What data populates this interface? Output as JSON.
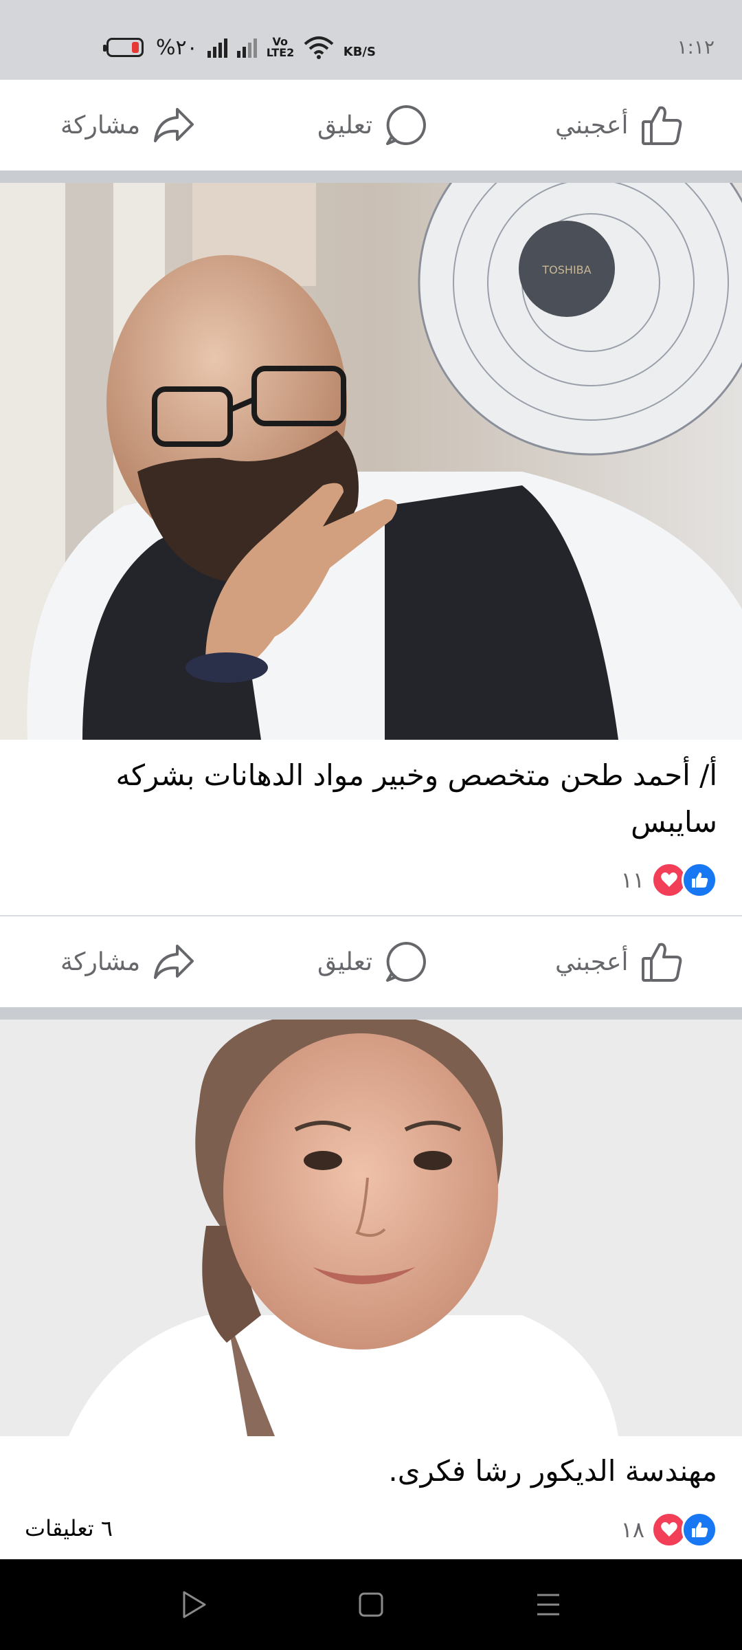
{
  "status_bar": {
    "time": "١:١٢",
    "battery_percent": "%٢٠",
    "network_speed": "KB/S",
    "volte": "Vo LTE2",
    "icons": [
      "battery-icon",
      "signal-icon",
      "signal-icon",
      "volte-icon",
      "wifi-icon"
    ]
  },
  "post_actions": {
    "like": "أعجبني",
    "comment": "تعليق",
    "share": "مشاركة"
  },
  "posts": [
    {
      "image_alt": "bald man with beard and glasses gesturing, fan in background",
      "caption": "أ/ أحمد طحن متخصص وخبير مواد الدهانات بشركه سايبس",
      "reaction_count": "١١",
      "reactions": [
        "like",
        "love"
      ]
    },
    {
      "image_alt": "smiling woman wearing brown headscarf",
      "caption": "مهندسة الديكور رشا فكرى.",
      "reaction_count": "١٨",
      "reactions": [
        "like",
        "love"
      ],
      "comments": "٦ تعليقات"
    }
  ],
  "colors": {
    "like_blue": "#1877f2",
    "love_red": "#f33e58",
    "action_gray": "#65676b",
    "separator": "#c9ccd1"
  },
  "nav_bar": {
    "icons": [
      "back-triangle-icon",
      "home-square-icon",
      "recents-menu-icon"
    ]
  }
}
